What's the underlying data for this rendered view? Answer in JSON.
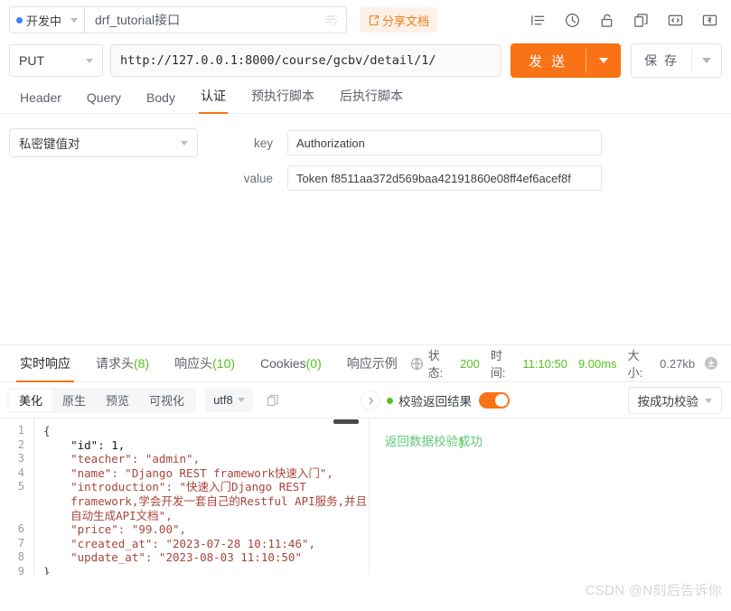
{
  "topbar": {
    "status_label": "开发中",
    "status_dot_color": "#3b82f6",
    "api_name": "drf_tutorial接口",
    "edit_icon": "edit-lines-icon",
    "share_label": "分享文档",
    "share_icon": "share-doc-icon",
    "icons": [
      {
        "name": "indent-list-icon"
      },
      {
        "name": "history-clock-icon"
      },
      {
        "name": "unlock-icon"
      },
      {
        "name": "copy-duplicate-icon"
      },
      {
        "name": "code-brackets-icon"
      },
      {
        "name": "export-icon"
      }
    ]
  },
  "request": {
    "method": "PUT",
    "url": "http://127.0.0.1:8000/course/gcbv/detail/1/",
    "send_label": "发 送",
    "save_label": "保 存",
    "send_color": "#f97316",
    "tabs": [
      {
        "label": "Header",
        "active": false
      },
      {
        "label": "Query",
        "active": false
      },
      {
        "label": "Body",
        "active": false
      },
      {
        "label": "认证",
        "active": true
      },
      {
        "label": "预执行脚本",
        "active": false
      },
      {
        "label": "后执行脚本",
        "active": false
      }
    ]
  },
  "auth": {
    "type_select": "私密键值对",
    "fields": [
      {
        "label": "key",
        "value": "Authorization"
      },
      {
        "label": "value",
        "value": "Token f8511aa372d569baa42191860e08ff4ef6acef8f"
      }
    ]
  },
  "response": {
    "tabs": [
      {
        "label": "实时响应",
        "count": "",
        "active": true
      },
      {
        "label": "请求头",
        "count": "(8)",
        "active": false
      },
      {
        "label": "响应头",
        "count": "(10)",
        "active": false
      },
      {
        "label": "Cookies",
        "count": "(0)",
        "active": false
      },
      {
        "label": "响应示例",
        "count": "",
        "active": false
      }
    ],
    "status": {
      "globe_icon": "globe-icon",
      "status_label": "状态:",
      "status_code": "200",
      "time_label": "时间:",
      "time_value": "11:10:50",
      "duration": "9.00ms",
      "size_label": "大小:",
      "size_value": "0.27kb",
      "download_icon": "download-icon",
      "ok_color": "#52c41a"
    },
    "toolbar": {
      "segments": [
        {
          "label": "美化",
          "active": true
        },
        {
          "label": "原生",
          "active": false
        },
        {
          "label": "预览",
          "active": false
        },
        {
          "label": "可视化",
          "active": false
        }
      ],
      "encoding": "utf8",
      "copy_icon": "copy-icon",
      "collapse_icon": "chevron-right-icon"
    },
    "verify": {
      "label": "校验返回结果",
      "toggle_on": true,
      "toggle_color": "#f97316",
      "rule_label": "按成功校验",
      "result_message": "返回数据校验成功",
      "result_color": "#5fc97a"
    },
    "code": {
      "line_numbers": [
        "1",
        "2",
        "3",
        "4",
        "5",
        "",
        "6",
        "7",
        "8",
        "9"
      ],
      "lines": [
        "{",
        "    \"id\": 1,",
        "    \"teacher\": \"admin\",",
        "    \"name\": \"Django REST framework快速入门\",",
        "    \"introduction\": \"快速入门Django REST",
        "    framework,学会开发一套自己的Restful API服务,并且",
        "    自动生成API文档\",",
        "    \"price\": \"99.00\",",
        "    \"created_at\": \"2023-07-28 10:11:46\",",
        "    \"update_at\": \"2023-08-03 11:10:50\"",
        "}"
      ]
    }
  },
  "watermark": "CSDN @N刻后告诉你"
}
